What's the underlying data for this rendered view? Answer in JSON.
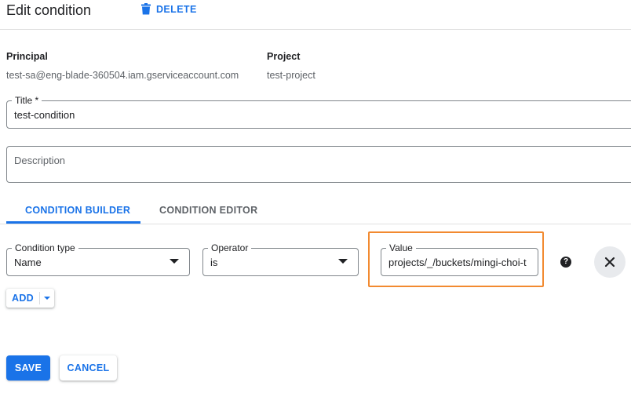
{
  "header": {
    "title": "Edit condition",
    "delete_label": "DELETE"
  },
  "info": {
    "principal_label": "Principal",
    "principal_value": "test-sa@eng-blade-360504.iam.gserviceaccount.com",
    "project_label": "Project",
    "project_value": "test-project"
  },
  "form": {
    "title_label": "Title *",
    "title_value": "test-condition",
    "description_placeholder": "Description"
  },
  "tabs": [
    {
      "label": "CONDITION BUILDER",
      "active": true
    },
    {
      "label": "CONDITION EDITOR",
      "active": false
    }
  ],
  "condition": {
    "type_label": "Condition type",
    "type_value": "Name",
    "operator_label": "Operator",
    "operator_value": "is",
    "value_label": "Value",
    "value_value": "projects/_/buckets/mingi-choi-t"
  },
  "icons": {
    "delete": "trash-icon",
    "help": "help-icon",
    "remove": "close-icon",
    "dropdown": "chevron-down-icon"
  },
  "buttons": {
    "add_label": "ADD",
    "save_label": "SAVE",
    "cancel_label": "CANCEL"
  },
  "colors": {
    "accent": "#1a73e8",
    "highlight": "#f28a30"
  }
}
